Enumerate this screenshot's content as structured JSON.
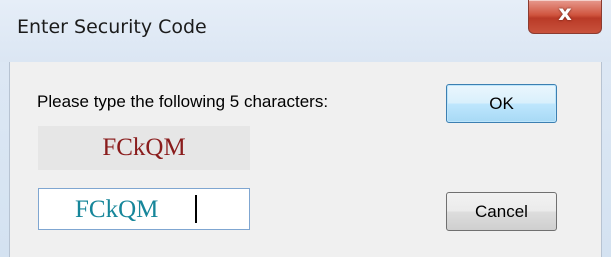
{
  "window": {
    "title": "Enter Security Code",
    "close_label": "x"
  },
  "dialog": {
    "prompt": "Please type the following 5 characters:",
    "security_code": "FCkQM",
    "input_value": "FCkQM"
  },
  "buttons": {
    "ok_label": "OK",
    "cancel_label": "Cancel"
  },
  "colors": {
    "code_text": "#8a1c1c",
    "input_text": "#16869a",
    "close_button": "#c9523c"
  }
}
